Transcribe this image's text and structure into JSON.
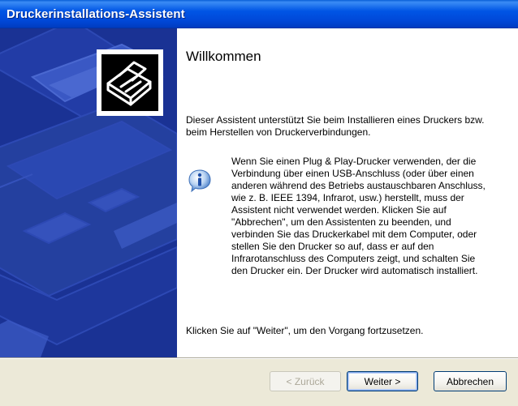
{
  "window": {
    "title": "Druckerinstallations-Assistent"
  },
  "wizard": {
    "heading": "Willkommen",
    "intro": "Dieser Assistent unterstützt Sie beim Installieren eines Druckers bzw. beim Herstellen von Druckerverbindungen.",
    "info": "Wenn Sie einen Plug & Play-Drucker verwenden, der die Verbindung über einen USB-Anschluss (oder über einen anderen während des Betriebs austauschbaren Anschluss, wie z. B. IEEE 1394, Infrarot, usw.) herstellt, muss der Assistent nicht verwendet werden. Klicken Sie auf \"Abbrechen\", um den Assistenten zu beenden, und verbinden Sie das Druckerkabel mit dem Computer, oder stellen Sie den Drucker so auf, dass er auf den Infrarotanschluss des Computers zeigt, und schalten Sie den Drucker ein. Der Drucker wird automatisch installiert.",
    "footer": "Klicken Sie auf \"Weiter\", um den Vorgang fortzusetzen."
  },
  "buttons": {
    "back": "< Zurück",
    "next": "Weiter >",
    "cancel": "Abbrechen"
  },
  "icons": {
    "header": "printer-icon",
    "info": "info-icon"
  },
  "colors": {
    "titlebar": "#0055e5",
    "side_panel": "#1a3294",
    "dialog_bg": "#ece9d8"
  }
}
